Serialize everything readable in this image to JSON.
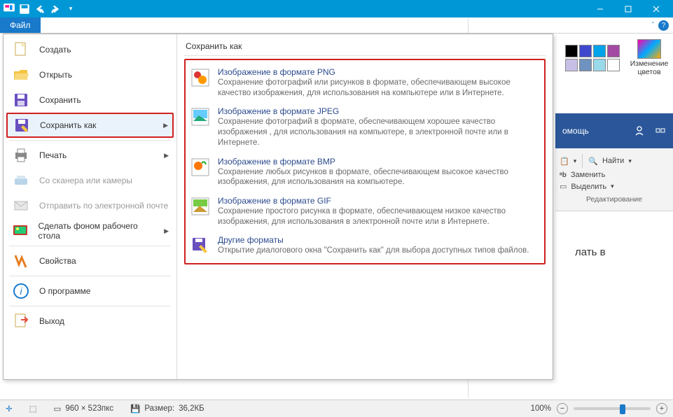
{
  "titlebar": {
    "window_controls": {
      "min": "minimize",
      "max": "maximize",
      "close": "close"
    }
  },
  "ribbon": {
    "file_tab": "Файл"
  },
  "file_menu": {
    "items": {
      "new": "Создать",
      "open": "Открыть",
      "save": "Сохранить",
      "save_as": "Сохранить как",
      "print": "Печать",
      "scanner": "Со сканера или камеры",
      "email": "Отправить по электронной почте",
      "wallpaper": "Сделать фоном рабочего стола",
      "properties": "Свойства",
      "about": "О программе",
      "exit": "Выход"
    },
    "submenu_title": "Сохранить как",
    "formats": {
      "png": {
        "label": "Изображение в формате PNG",
        "desc": "Сохранение фотографий или рисунков в формате, обеспечивающем высокое качество изображения, для использования на компьютере или в Интернете."
      },
      "jpeg": {
        "label": "Изображение в формате JPEG",
        "desc": "Сохранение фотографий в формате, обеспечивающем хорошее качество изображения , для использования на компьютере, в электронной почте или в Интернете."
      },
      "bmp": {
        "label": "Изображение в формате BMP",
        "desc": "Сохранение любых рисунков в формате, обеспечивающем высокое качество изображения, для использования на компьютере."
      },
      "gif": {
        "label": "Изображение в формате GIF",
        "desc": "Сохранение простого рисунка в формате, обеспечивающем низкое качество изображения, для использования в электронной почте или в Интернете."
      },
      "other": {
        "label": "Другие форматы",
        "desc": "Открытие диалогового окна \"Сохранить как\" для выбора доступных типов файлов."
      }
    }
  },
  "palette": {
    "edit_label": "Изменение цветов",
    "colors": [
      "#000000",
      "#7f7f7f",
      "#880015",
      "#ed1c24",
      "#3f48cc",
      "#00a2e8",
      "#22b14c",
      "#b5e61d"
    ]
  },
  "word_panel": {
    "tab_hint": "омощь",
    "find": "Найти",
    "replace": "Заменить",
    "select": "Выделить",
    "group": "Редактирование",
    "body_text": "лать в"
  },
  "status": {
    "canvas_size": "960 × 523пкс",
    "file_size_label": "Размер:",
    "file_size": "36,2КБ",
    "zoom": "100%"
  }
}
